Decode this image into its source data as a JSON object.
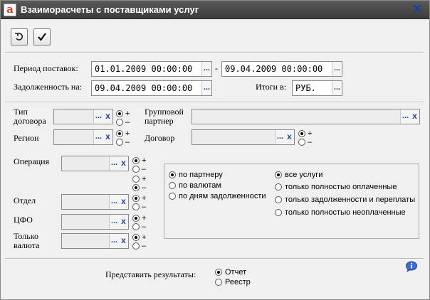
{
  "window": {
    "title": "Взаиморасчеты с поставщиками услуг",
    "logo_letter": "a"
  },
  "toolbar": {
    "undo_icon": "undo-icon",
    "apply_icon": "check-icon"
  },
  "period": {
    "label": "Период поставок:",
    "from_value": "01.01.2009 00:00:00",
    "dash": "-",
    "to_value": "09.04.2009 00:00:00"
  },
  "debt": {
    "label": "Задолженность на:",
    "value": "09.04.2009 00:00:00"
  },
  "totals": {
    "label": "Итоги в:",
    "value": "РУБ."
  },
  "filters": {
    "contract_type_label": "Тип договора",
    "region_label": "Регион",
    "group_partner_label": "Групповой партнер",
    "contract_label": "Договор",
    "operation_label": "Операция",
    "department_label": "Отдел",
    "cfo_label": "ЦФО",
    "currency_only_label": "Только валюта",
    "plus": "+",
    "minus": "–",
    "dots": "...",
    "clear": "x"
  },
  "grouping": {
    "options": [
      "по партнеру",
      "по валютам",
      "по дням задолженности"
    ],
    "selected": 0
  },
  "services": {
    "options": [
      "все услуги",
      "только полностью оплаченные",
      "только задолженности и переплаты",
      "только полностью неоплаченные"
    ],
    "selected": 0
  },
  "output": {
    "label": "Представить результаты:",
    "options": [
      "Отчет",
      "Реестр"
    ],
    "selected": 0
  },
  "colors": {
    "accent": "#1f3f9f",
    "title_bg": "#4a4a4a"
  }
}
